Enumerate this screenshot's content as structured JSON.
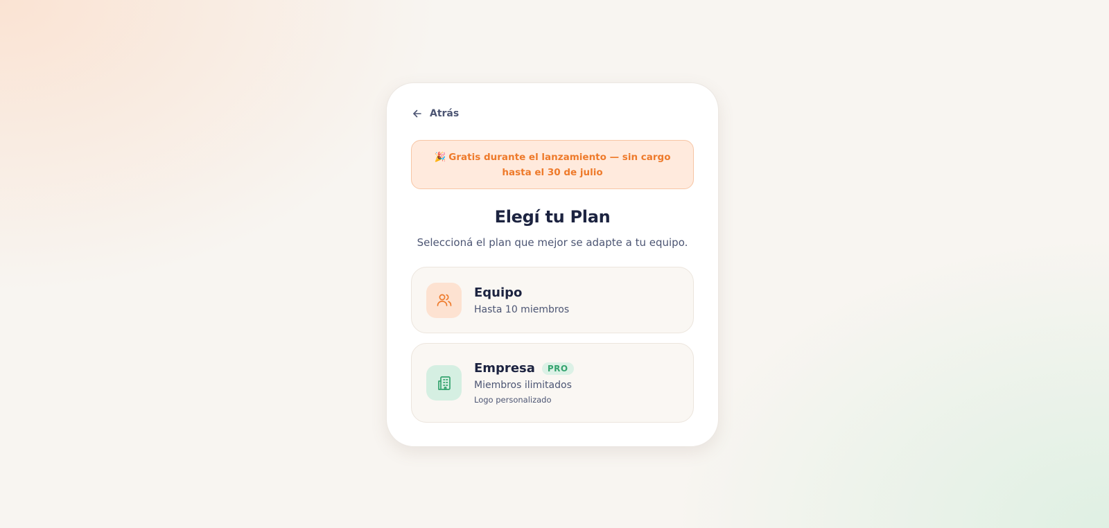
{
  "back": {
    "label": "Atrás",
    "icon": "arrow-left-icon"
  },
  "banner": {
    "emoji": "🎉",
    "text": "Gratis durante el lanzamiento — sin cargo hasta el 30 de julio"
  },
  "heading": {
    "title": "Elegí tu Plan",
    "subtitle": "Seleccioná el plan que mejor se adapte a tu equipo."
  },
  "plans": [
    {
      "name": "Equipo",
      "description": "Hasta 10 miembros",
      "icon": "users-icon",
      "accent": "#ee7a2b"
    },
    {
      "name": "Empresa",
      "badge": "PRO",
      "description": "Miembros ilimitados",
      "note": "Logo personalizado",
      "icon": "building-icon",
      "accent": "#34a36e"
    }
  ],
  "colors": {
    "text_dark": "#1c2340",
    "text_muted": "#4c5573",
    "orange": "#ee7a2b",
    "green": "#34a36e"
  }
}
